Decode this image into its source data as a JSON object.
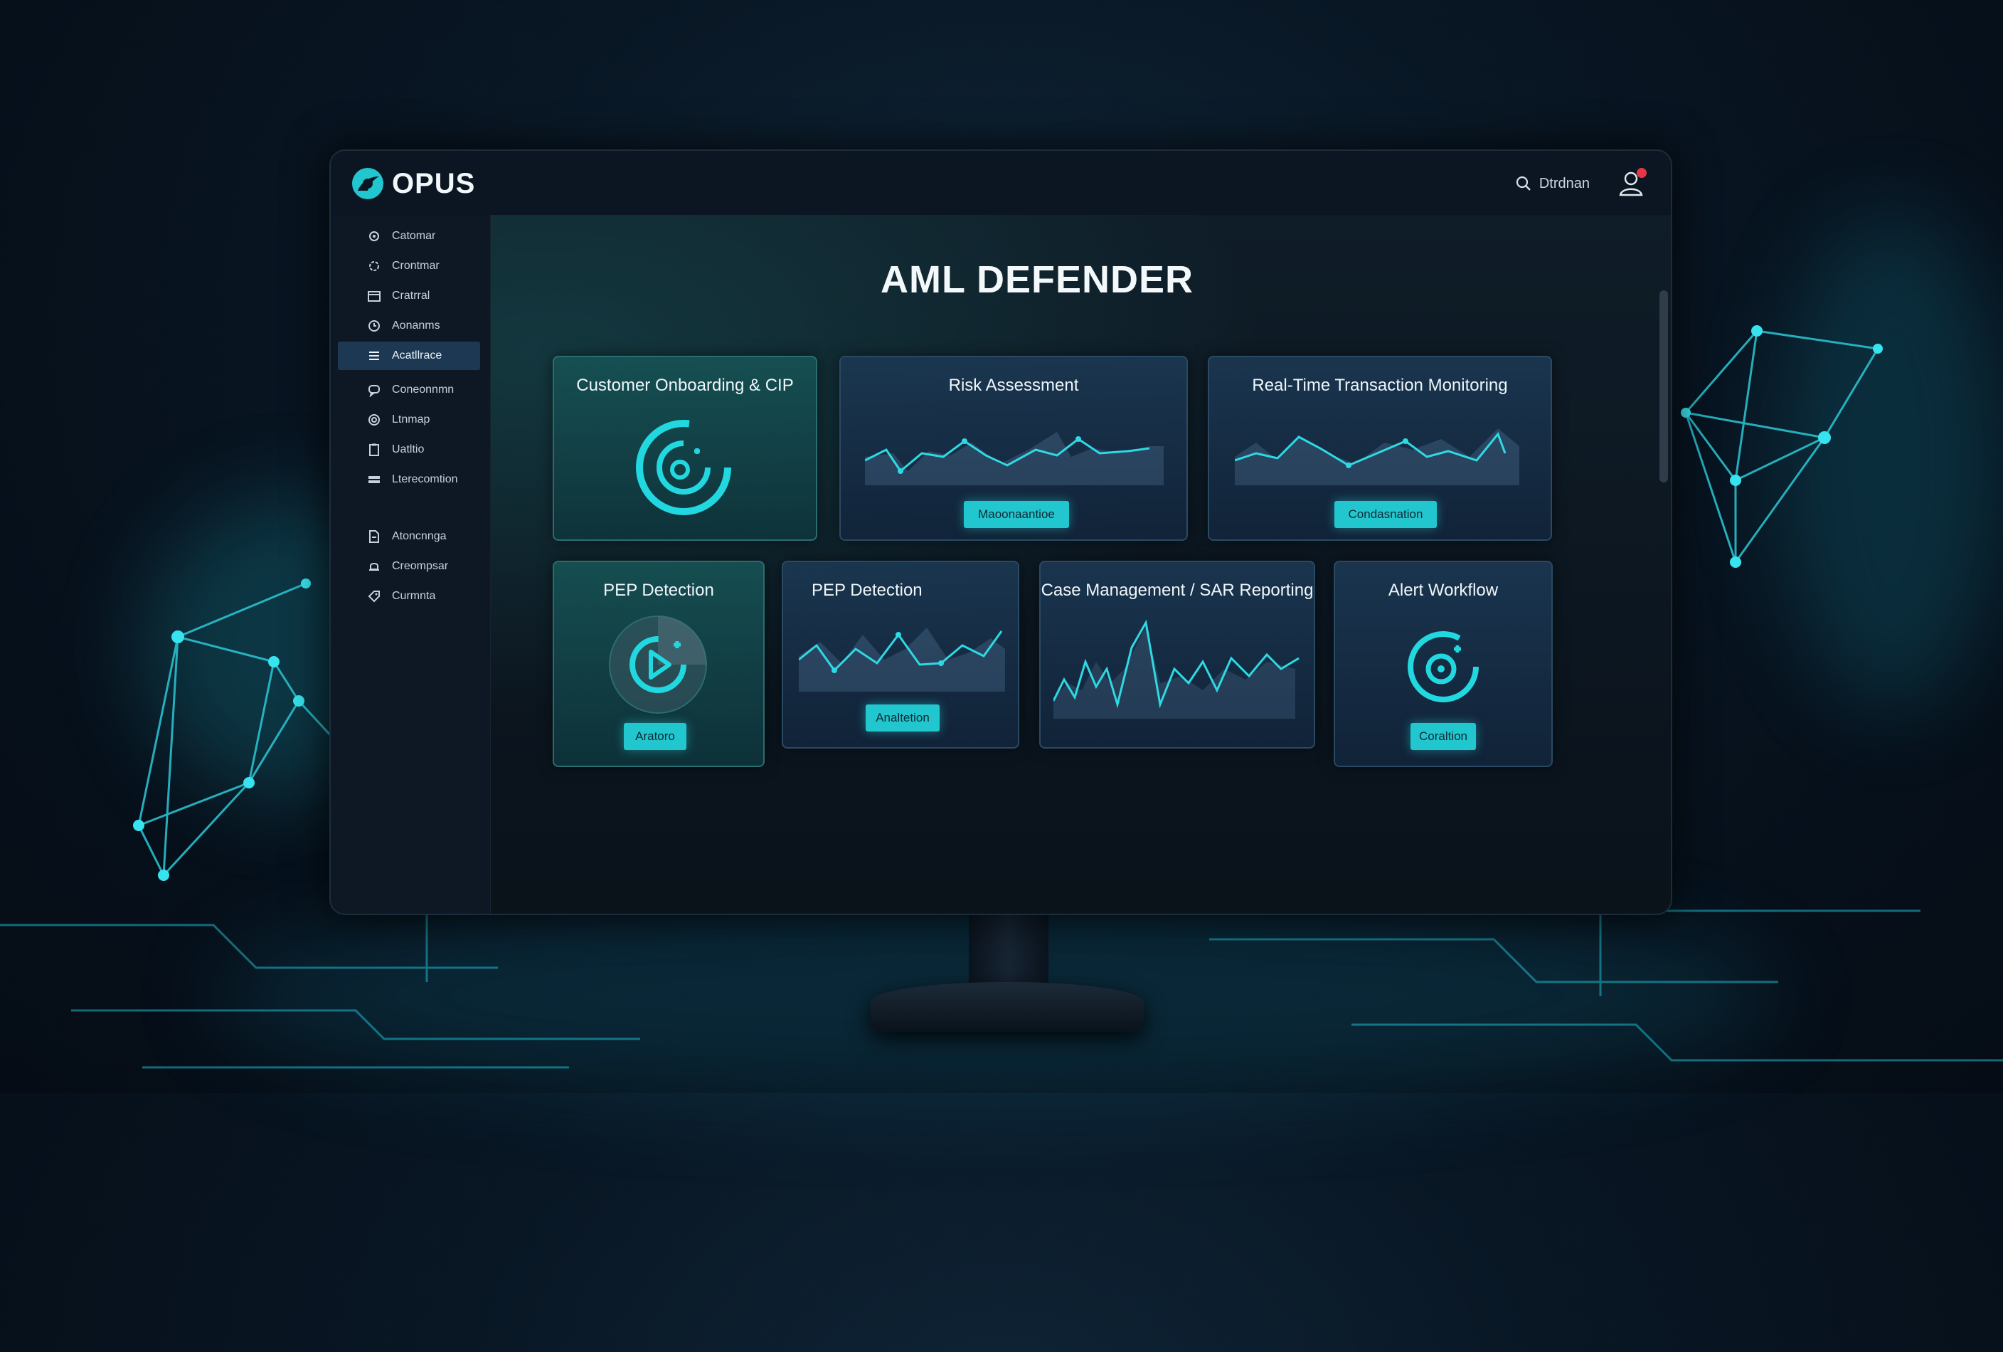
{
  "app": {
    "name": "OPUS",
    "page_title": "AML DEFENDER"
  },
  "header": {
    "search_label": "Dtrdnan"
  },
  "sidebar": {
    "items": [
      {
        "label": "Catomar",
        "icon": "gear-icon"
      },
      {
        "label": "Crontmar",
        "icon": "gear-icon"
      },
      {
        "label": "Cratrral",
        "icon": "calendar-icon"
      },
      {
        "label": "Aonanms",
        "icon": "clock-icon"
      },
      {
        "label": "Acatllrace",
        "icon": "list-icon",
        "active": true
      },
      {
        "label": "Coneonnmn",
        "icon": "chat-icon"
      },
      {
        "label": "Ltnmap",
        "icon": "settings-icon"
      },
      {
        "label": "Uatltio",
        "icon": "clipboard-icon"
      },
      {
        "label": "Lterecomtion",
        "icon": "stack-icon"
      },
      {
        "label": "Atoncnnga",
        "icon": "document-icon"
      },
      {
        "label": "Creompsar",
        "icon": "bell-icon"
      },
      {
        "label": "Curmnta",
        "icon": "tag-icon"
      }
    ]
  },
  "cards": [
    {
      "title": "Customer Onboarding & CIP",
      "icon": "target-settings-icon"
    },
    {
      "title": "Risk Assessment",
      "button": "Maoonaantioe"
    },
    {
      "title": "Real-Time Transaction Monitoring",
      "button": "Condasnation"
    },
    {
      "title": "PEP Detection",
      "button": "Aratoro",
      "icon": "play-target-icon"
    },
    {
      "title": "PEP Detection",
      "button": "Analtetion"
    },
    {
      "title": "Case Management / SAR Reporting"
    },
    {
      "title": "Alert Workflow",
      "button": "Coraltion",
      "icon": "target-icon"
    }
  ],
  "colors": {
    "accent": "#22c6cf",
    "alert_dot": "#e53646",
    "active_nav": "#1d3852"
  }
}
